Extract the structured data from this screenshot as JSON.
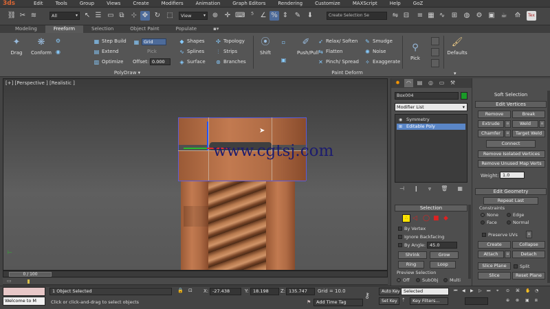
{
  "app": {
    "logo": "3ds"
  },
  "menu": [
    "Edit",
    "Tools",
    "Group",
    "Views",
    "Create",
    "Modifiers",
    "Animation",
    "Graph Editors",
    "Rendering",
    "Customize",
    "MAXScript",
    "Help",
    "GoZ"
  ],
  "toolbar": {
    "filter_value": "All",
    "ref_coord_value": "View",
    "selection_set_placeholder": "Create Selection Se",
    "icons": [
      "link-icon",
      "unlink-icon",
      "bind-space-warp-icon",
      "select-object-icon",
      "select-by-name-icon",
      "rect-region-icon",
      "window-crossing-icon",
      "move-icon",
      "rotate-icon",
      "scale-icon",
      "pivot-icon",
      "snap-icon",
      "angle-snap-icon",
      "percent-snap-icon",
      "spinner-snap-icon",
      "mirror-icon",
      "align-icon",
      "layer-icon",
      "curve-editor-icon",
      "schematic-icon",
      "material-editor-icon",
      "render-setup-icon",
      "render-frame-icon",
      "render-icon"
    ]
  },
  "ribbon_tabs": [
    {
      "label": "Modeling",
      "active": false
    },
    {
      "label": "Freeform",
      "active": true
    },
    {
      "label": "Selection",
      "active": false
    },
    {
      "label": "Object Paint",
      "active": false
    },
    {
      "label": "Populate",
      "active": false
    }
  ],
  "ribbon": {
    "polydraw": {
      "drag": "Drag",
      "conform": "Conform",
      "step_build": "Step Build",
      "extend": "Extend",
      "optimize": "Optimize",
      "grid": "Grid",
      "pick": "Pick",
      "offset_label": "Offset:",
      "offset_value": "0.000",
      "shapes": "Shapes",
      "splines": "Splines",
      "surface": "Surface",
      "topology": "Topology",
      "strips": "Strips",
      "branches": "Branches",
      "group_label": "PolyDraw ▾"
    },
    "paint_deform": {
      "shift": "Shift",
      "push_pull": "Push/Pull",
      "relax_soften": "Relax/ Soften",
      "flatten": "Flatten",
      "pinch_spread": "Pinch/ Spread",
      "smudge": "Smudge",
      "noise": "Noise",
      "exaggerate": "Exaggerate",
      "group_label": "Paint Deform"
    },
    "pick": "Pick",
    "defaults": "Defaults"
  },
  "viewport": {
    "label": "[+] [Perspective ] [Realistic ]",
    "watermark": "www.cgtsj.com"
  },
  "timeline": {
    "slider": "0 / 100"
  },
  "status": {
    "maxscript_text": "Welcome to M",
    "selected": "1 Object Selected",
    "prompt": "Click or click-and-drag to select objects",
    "x_label": "X:",
    "x_value": "-27.438",
    "y_label": "Y:",
    "y_value": "18.198",
    "z_label": "Z:",
    "z_value": "135.747",
    "grid": "Grid = 10.0",
    "add_time_tag": "Add Time Tag",
    "auto_key": "Auto Key",
    "set_key": "Set Key",
    "key_mode": "Selected",
    "key_filters": "Key Filters..."
  },
  "command_panel": {
    "object_name": "Box004",
    "modifier_list": "Modifier List",
    "stack": [
      {
        "label": "Symmetry",
        "selected": false
      },
      {
        "label": "Editable Poly",
        "selected": true
      }
    ],
    "selection": {
      "title": "Selection",
      "by_vertex": "By Vertex",
      "ignore_backfacing": "Ignore Backfacing",
      "by_angle": "By Angle:",
      "by_angle_value": "45.0",
      "shrink": "Shrink",
      "grow": "Grow",
      "ring": "Ring",
      "loop": "Loop",
      "preview_selection": "Preview Selection",
      "off": "Off",
      "subobj": "SubObj",
      "multi": "Multi"
    }
  },
  "edit_panel": {
    "soft_selection": "Soft Selection",
    "edit_vertices": "Edit Vertices",
    "remove": "Remove",
    "break": "Break",
    "extrude": "Extrude",
    "weld": "Weld",
    "chamfer": "Chamfer",
    "target_weld": "Target Weld",
    "connect": "Connect",
    "remove_isolated": "Remove Isolated Vertices",
    "remove_unused": "Remove Unused Map Verts",
    "weight_label": "Weight:",
    "weight_value": "1.0",
    "edit_geometry": "Edit Geometry",
    "repeat_last": "Repeat Last",
    "constraints": "Constraints",
    "none": "None",
    "edge": "Edge",
    "face": "Face",
    "normal": "Normal",
    "preserve_uvs": "Preserve UVs",
    "create": "Create",
    "collapse": "Collapse",
    "attach": "Attach",
    "detach": "Detach",
    "slice_plane": "Slice Plane",
    "split": "Split",
    "slice": "Slice",
    "reset_plane": "Reset Plane"
  },
  "colors": {
    "accent": "#5a86c7",
    "object_color": "#1a9a28",
    "watermark": "#1c1c6e"
  }
}
